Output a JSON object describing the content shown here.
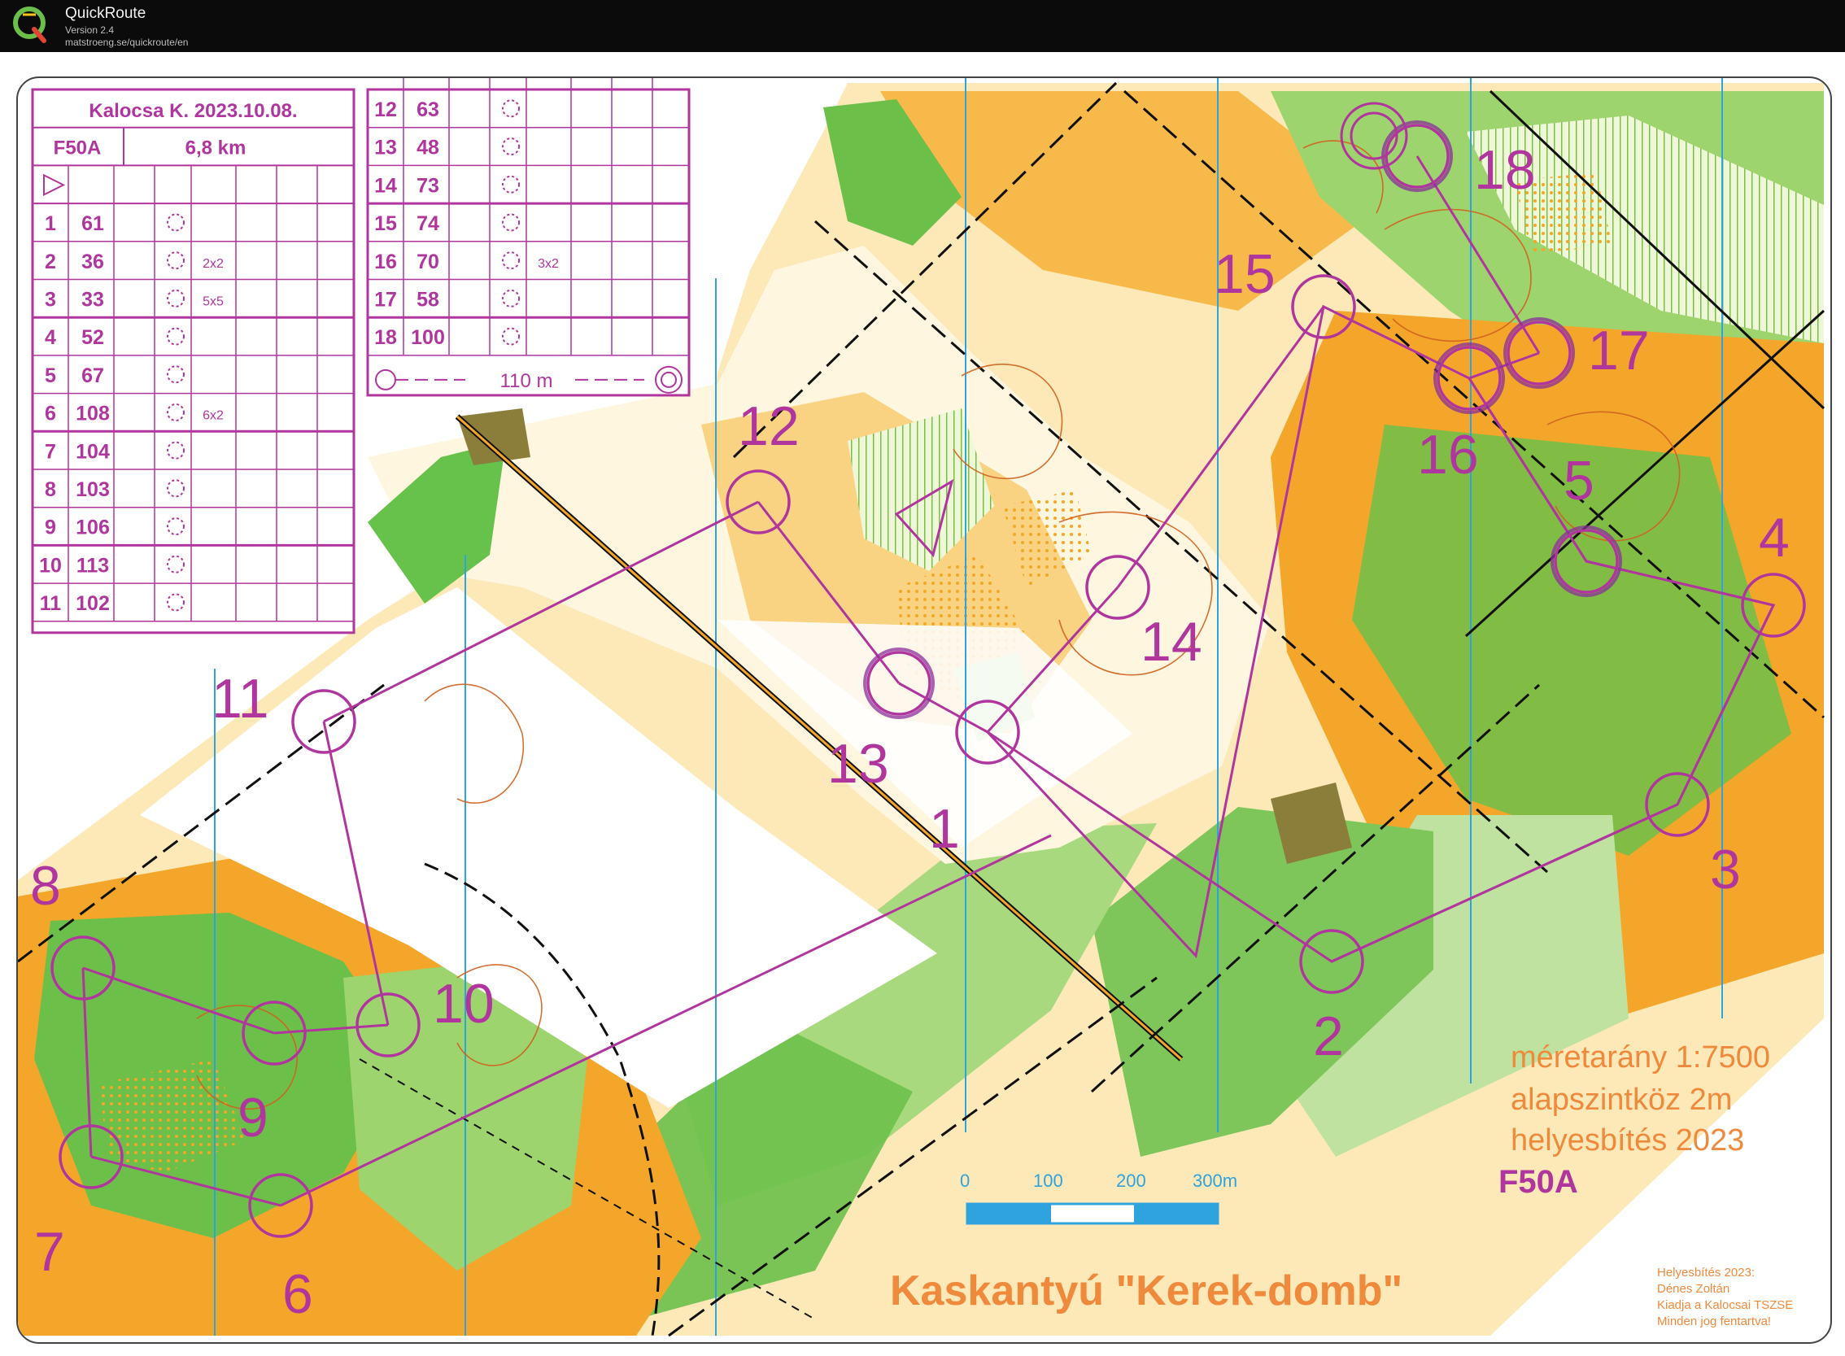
{
  "window": {
    "app_name": "QuickRoute",
    "version": "Version 2.4",
    "url": "matstroeng.se/quickroute/en"
  },
  "icons": {
    "app_logo": "quickroute-q-logo-icon"
  },
  "colors": {
    "course_magenta": "#b0369e",
    "route_purple": "#8a2f9a",
    "open_land_orange": "#f5a623",
    "rough_open_yellow": "#fbd56a",
    "forest_green": "#66c24a",
    "light_green": "#bfe2a0",
    "contour_brown": "#d0601e",
    "water_blue": "#2ea3de",
    "black_features": "#111111"
  },
  "map": {
    "map_title": "Kaskantyú \"Kerek-domb\"",
    "scale_text": "méretarány  1:7500",
    "contour_text": "alapszintköz  2m",
    "revision_text": "helyesbítés  2023",
    "course_code": "F50A",
    "credits": [
      "Helyesbítés 2023:",
      "Dénes Zoltán",
      "Kiadja a Kalocsai TSZSE",
      "Minden jog fentartva!"
    ],
    "scalebar_labels": [
      "0",
      "100",
      "200",
      "300m"
    ],
    "control_number_labels": [
      "1",
      "2",
      "3",
      "4",
      "5",
      "6",
      "7",
      "8",
      "9",
      "10",
      "11",
      "12",
      "13",
      "14",
      "15",
      "16",
      "17",
      "18"
    ]
  },
  "description_sheet": {
    "event": "Kalocsa K. 2023.10.08.",
    "course": "F50A",
    "length": "6,8 km",
    "rows_left": [
      {
        "n": "1",
        "code": "61",
        "extra": ""
      },
      {
        "n": "2",
        "code": "36",
        "extra": "2x2"
      },
      {
        "n": "3",
        "code": "33",
        "extra": "5x5"
      },
      {
        "n": "4",
        "code": "52",
        "extra": ""
      },
      {
        "n": "5",
        "code": "67",
        "extra": ""
      },
      {
        "n": "6",
        "code": "108",
        "extra": "6x2"
      },
      {
        "n": "7",
        "code": "104",
        "extra": ""
      },
      {
        "n": "8",
        "code": "103",
        "extra": ""
      },
      {
        "n": "9",
        "code": "106",
        "extra": ""
      },
      {
        "n": "10",
        "code": "113",
        "extra": ""
      },
      {
        "n": "11",
        "code": "102",
        "extra": ""
      }
    ],
    "rows_right": [
      {
        "n": "12",
        "code": "63",
        "extra": ""
      },
      {
        "n": "13",
        "code": "48",
        "extra": ""
      },
      {
        "n": "14",
        "code": "73",
        "extra": ""
      },
      {
        "n": "15",
        "code": "74",
        "extra": ""
      },
      {
        "n": "16",
        "code": "70",
        "extra": "3x2"
      },
      {
        "n": "17",
        "code": "58",
        "extra": ""
      },
      {
        "n": "18",
        "code": "100",
        "extra": ""
      }
    ],
    "finish_distance": "110 m"
  }
}
